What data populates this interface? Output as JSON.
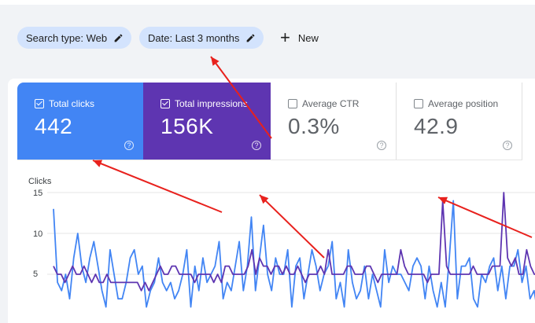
{
  "filters": {
    "search_type": "Search type: Web",
    "date": "Date: Last 3 months",
    "new_label": "New"
  },
  "metrics": [
    {
      "label": "Total clicks",
      "value": "442",
      "checked": true,
      "color": "#4285f4"
    },
    {
      "label": "Total impressions",
      "value": "156K",
      "checked": true,
      "color": "#5e35b1"
    },
    {
      "label": "Average CTR",
      "value": "0.3%",
      "checked": false
    },
    {
      "label": "Average position",
      "value": "42.9",
      "checked": false
    }
  ],
  "help_icon": "?",
  "chart_data": {
    "type": "line",
    "ylabel": "Clicks",
    "yticks": [
      "15",
      "10",
      "5"
    ],
    "ylim": [
      0,
      16
    ],
    "series": [
      {
        "color": "#4285f4",
        "values": [
          13,
          4,
          3,
          5,
          2,
          7,
          10,
          6,
          4,
          7,
          9,
          6,
          3,
          1,
          8,
          5,
          2,
          2,
          4,
          7,
          8,
          5,
          6,
          1,
          3,
          4,
          7,
          4,
          3,
          4,
          2,
          3,
          5,
          8,
          1,
          6,
          3,
          7,
          4,
          5,
          6,
          9,
          2,
          4,
          3,
          6,
          9,
          3,
          6,
          12,
          3,
          7,
          11,
          5,
          3,
          7,
          5,
          5,
          8,
          1,
          6,
          7,
          2,
          5,
          8,
          6,
          3,
          5,
          6,
          9,
          2,
          4,
          1,
          8,
          4,
          2,
          3,
          6,
          2,
          5,
          3,
          1,
          8,
          4,
          6,
          5,
          5,
          4,
          3,
          6,
          7,
          6,
          2,
          6,
          3,
          1,
          4,
          1,
          7,
          14,
          2,
          6,
          6,
          7,
          2,
          1,
          5,
          4,
          6,
          7,
          3,
          6,
          2,
          6,
          6,
          8,
          4,
          6,
          2,
          3,
          0
        ]
      },
      {
        "color": "#5e35b1",
        "values": [
          6,
          5,
          5,
          4,
          5,
          6,
          5,
          5,
          6,
          5,
          4,
          5,
          4,
          4,
          5,
          4,
          4,
          4,
          4,
          4,
          4,
          4,
          4,
          3,
          4,
          3,
          4,
          5,
          6,
          5,
          5,
          6,
          6,
          5,
          5,
          5,
          5,
          4,
          5,
          5,
          5,
          5,
          4,
          5,
          4,
          6,
          6,
          5,
          5,
          5,
          5,
          6,
          8,
          5,
          7,
          6,
          6,
          5,
          6,
          6,
          5,
          6,
          5,
          5,
          6,
          5,
          4,
          5,
          5,
          5,
          6,
          5,
          8,
          5,
          5,
          5,
          5,
          6,
          6,
          5,
          5,
          5,
          6,
          6,
          5,
          4,
          5,
          5,
          5,
          5,
          5,
          8,
          6,
          5,
          5,
          5,
          5,
          5,
          4,
          5,
          5,
          5,
          14,
          6,
          5,
          5,
          5,
          5,
          5,
          5,
          6,
          5,
          5,
          5,
          5,
          6,
          6,
          6,
          15,
          7,
          6,
          7,
          5,
          5,
          8,
          6,
          5,
          5
        ]
      }
    ]
  },
  "annotations": {
    "arrow_color": "#e8211d"
  }
}
